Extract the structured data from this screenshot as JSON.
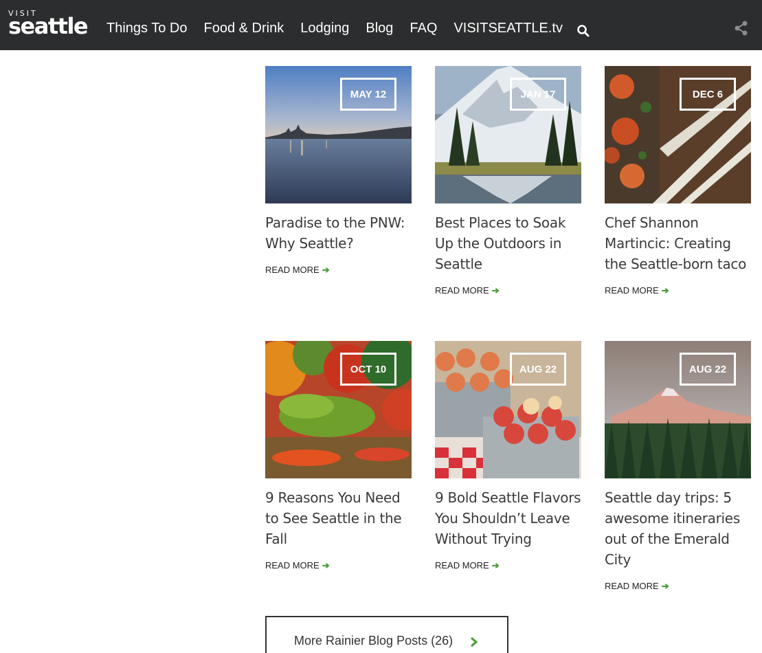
{
  "header": {
    "logo_top": "VISIT",
    "logo_main": "seattle",
    "nav": [
      "Things To Do",
      "Food & Drink",
      "Lodging",
      "Blog",
      "FAQ",
      "VISITSEATTLE.tv"
    ],
    "search_icon": "search-icon",
    "share_icon": "share-icon"
  },
  "posts": [
    {
      "date": "MAY 12",
      "title": "Paradise to the PNW: Why Seattle?",
      "read_more": "READ MORE",
      "arrow": "➔"
    },
    {
      "date": "JAN 17",
      "title": "Best Places to Soak Up the Outdoors in Seattle",
      "read_more": "READ MORE",
      "arrow": "➔"
    },
    {
      "date": "DEC 6",
      "title": "Chef Shannon Martincic: Creating the Seattle-born taco",
      "read_more": "READ MORE",
      "arrow": "➔"
    },
    {
      "date": "OCT 10",
      "title": "9 Reasons You Need to See Seattle in the Fall",
      "read_more": "READ MORE",
      "arrow": "➔"
    },
    {
      "date": "AUG 22",
      "title": "9 Bold Seattle Flavors You Shouldn’t Leave Without Trying",
      "read_more": "READ MORE",
      "arrow": "➔"
    },
    {
      "date": "AUG 22",
      "title": "Seattle day trips: 5 awesome itineraries out of the Emerald City",
      "read_more": "READ MORE",
      "arrow": "➔"
    }
  ],
  "more_button": {
    "label": "More Rainier Blog Posts (26)"
  },
  "colors": {
    "header_bg": "#2b2d2e",
    "accent_green": "#4a9a3a"
  }
}
